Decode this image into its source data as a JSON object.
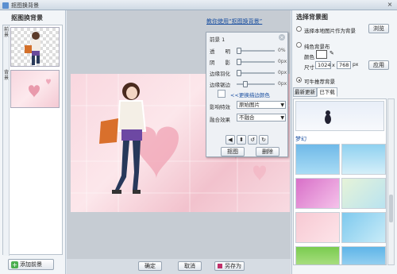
{
  "window": {
    "title": "抠图换背景",
    "close": "×"
  },
  "left": {
    "title": "抠图换背景",
    "tab1": "前景",
    "tab2": "背景",
    "add_button": "添加前景"
  },
  "center": {
    "help_link": "教你使用“抠图换背景”"
  },
  "panel": {
    "title": "前景 1",
    "close": "×",
    "sliders": [
      {
        "label": "透　　明",
        "value": "0%",
        "level": 0.0
      },
      {
        "label": "阴　　影",
        "value": "0px",
        "level": 0.0
      },
      {
        "label": "边缘羽化",
        "value": "0px",
        "level": 0.0
      },
      {
        "label": "边缘锯边",
        "value": "0px",
        "level": 0.18
      }
    ],
    "edge_color_button": "<<更换描边颜色",
    "effect_label": "影响特效",
    "effect_value": "原始图片",
    "blend_label": "融合效果",
    "blend_value": "不融合",
    "cutout_button": "抠图",
    "delete_button": "删除"
  },
  "bottom": {
    "ok": "确定",
    "cancel": "取消",
    "saveas": "另存为"
  },
  "right": {
    "title": "选择背景图",
    "local_option": "选择本地图片作为背景",
    "browse_button": "浏览",
    "solid_option": "纯色背景布",
    "color_label": "颜色",
    "size_label": "尺寸",
    "width": "1024",
    "height": "768",
    "px_unit": "px",
    "apply_button": "应用",
    "recommend_option": "可牛推荐背景",
    "tab_recent": "最新更新",
    "tab_downloaded": "已下载",
    "group_label": "梦幻"
  },
  "colors": {
    "accent": "#1a4fa0",
    "stage_pink": "#f9d7df"
  }
}
